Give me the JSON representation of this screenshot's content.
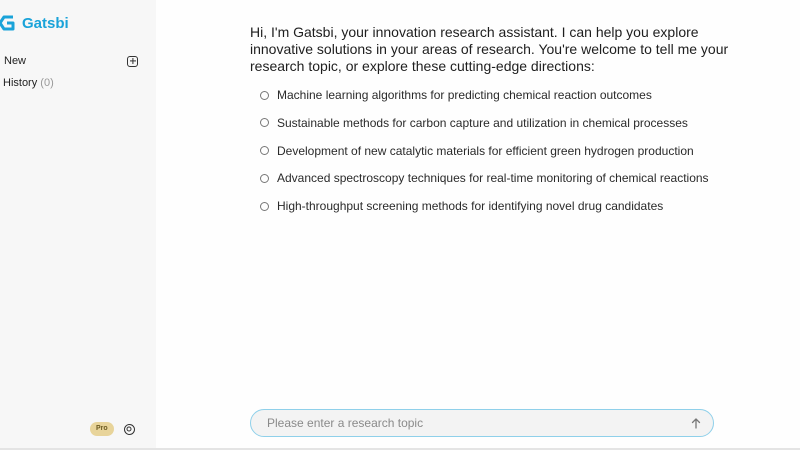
{
  "brand": {
    "name": "Gatsbi",
    "logo_icon": "gatsbi-logo-icon",
    "color": "#1aa3d9"
  },
  "sidebar": {
    "new_label": "New",
    "new_icon": "plus-square-icon",
    "history_label": "History",
    "history_count": "(0)",
    "pro_badge": "Pro",
    "settings_icon": "settings-icon"
  },
  "main": {
    "intro": "Hi, I'm Gatsbi, your innovation research assistant. I can help you explore innovative solutions in your areas of research. You're welcome to tell me your research topic, or explore these cutting-edge directions:",
    "options": [
      "Machine learning algorithms for predicting chemical reaction outcomes",
      "Sustainable methods for carbon capture and utilization in chemical processes",
      "Development of new catalytic materials for efficient green hydrogen production",
      "Advanced spectroscopy techniques for real-time monitoring of chemical reactions",
      "High-throughput screening methods for identifying novel drug candidates"
    ]
  },
  "input": {
    "placeholder": "Please enter a research topic",
    "value": "",
    "send_icon": "arrow-up-icon",
    "border_color": "#8fd0ea"
  }
}
